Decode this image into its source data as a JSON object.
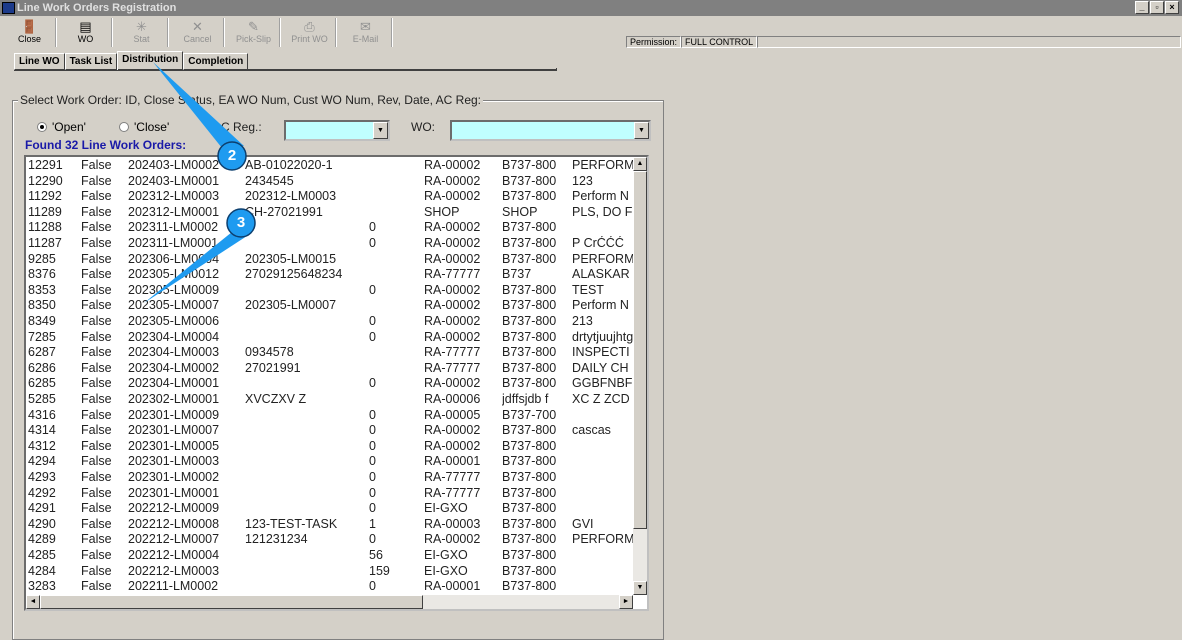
{
  "window": {
    "title": "Line Work Orders Registration"
  },
  "toolbar": [
    {
      "label": "Close",
      "icon": "door-exit-icon",
      "enabled": true
    },
    {
      "label": "WO",
      "icon": "printer-icon",
      "enabled": true
    },
    {
      "label": "Stat",
      "icon": "stat-icon",
      "enabled": false
    },
    {
      "label": "Cancel",
      "icon": "x-icon",
      "enabled": false
    },
    {
      "label": "Pick-Slip",
      "icon": "pick-slip-icon",
      "enabled": false
    },
    {
      "label": "Print WO",
      "icon": "print-icon",
      "enabled": false
    },
    {
      "label": "E-Mail",
      "icon": "email-icon",
      "enabled": false
    }
  ],
  "permission": {
    "label": "Permission:",
    "value": "FULL CONTROL"
  },
  "tabs": [
    "Line WO",
    "Task List",
    "Distribution",
    "Completion"
  ],
  "active_tab": "Distribution",
  "group": {
    "legend": "Select Work Order: ID, Close Status, EA WO Num, Cust WO Num, Rev, Date, AC Reg:",
    "radio_open": "'Open'",
    "radio_close": "'Close'",
    "ac_reg_label": "AC Reg.:",
    "wo_label": "WO:",
    "ac_reg_value": "",
    "wo_value": ""
  },
  "found": "Found 32 Line Work Orders:",
  "rows": [
    [
      "12291",
      "False",
      "202403-LM0002",
      "AB-01022020-1",
      "",
      "RA-00002",
      "B737-800",
      "PERFORM"
    ],
    [
      "12290",
      "False",
      "202403-LM0001",
      "2434545",
      "",
      "RA-00002",
      "B737-800",
      "123"
    ],
    [
      "11292",
      "False",
      "202312-LM0003",
      "202312-LM0003",
      "",
      "RA-00002",
      "B737-800",
      "Perform N"
    ],
    [
      "11289",
      "False",
      "202312-LM0001",
      "CH-27021991",
      "",
      "SHOP",
      "SHOP",
      "PLS, DO F"
    ],
    [
      "11288",
      "False",
      "202311-LM0002",
      "",
      "0",
      "RA-00002",
      "B737-800",
      ""
    ],
    [
      "11287",
      "False",
      "202311-LM0001",
      "",
      "0",
      "RA-00002",
      "B737-800",
      "P CrĆĆĆ"
    ],
    [
      "9285",
      "False",
      "202306-LM0004",
      "202305-LM0015",
      "",
      "RA-00002",
      "B737-800",
      "PERFORM"
    ],
    [
      "8376",
      "False",
      "202305-LM0012",
      "27029125648234",
      "",
      "RA-77777",
      "B737",
      "ALASKAR"
    ],
    [
      "8353",
      "False",
      "202305-LM0009",
      "",
      "0",
      "RA-00002",
      "B737-800",
      "TEST"
    ],
    [
      "8350",
      "False",
      "202305-LM0007",
      "202305-LM0007",
      "",
      "RA-00002",
      "B737-800",
      "Perform N"
    ],
    [
      "8349",
      "False",
      "202305-LM0006",
      "",
      "0",
      "RA-00002",
      "B737-800",
      "213"
    ],
    [
      "7285",
      "False",
      "202304-LM0004",
      "",
      "0",
      "RA-00002",
      "B737-800",
      "drtytjuujhtg"
    ],
    [
      "6287",
      "False",
      "202304-LM0003",
      "0934578",
      "",
      "RA-77777",
      "B737-800",
      "INSPECTI"
    ],
    [
      "6286",
      "False",
      "202304-LM0002",
      "27021991",
      "",
      "RA-77777",
      "B737-800",
      "DAILY CH"
    ],
    [
      "6285",
      "False",
      "202304-LM0001",
      "",
      "0",
      "RA-00002",
      "B737-800",
      "GGBFNBF"
    ],
    [
      "5285",
      "False",
      "202302-LM0001",
      "XVCZXV Z",
      "",
      "RA-00006",
      "jdffsjdb f",
      "XC Z ZCD"
    ],
    [
      "4316",
      "False",
      "202301-LM0009",
      "",
      "0",
      "RA-00005",
      "B737-700",
      ""
    ],
    [
      "4314",
      "False",
      "202301-LM0007",
      "",
      "0",
      "RA-00002",
      "B737-800",
      "cascas"
    ],
    [
      "4312",
      "False",
      "202301-LM0005",
      "",
      "0",
      "RA-00002",
      "B737-800",
      ""
    ],
    [
      "4294",
      "False",
      "202301-LM0003",
      "",
      "0",
      "RA-00001",
      "B737-800",
      ""
    ],
    [
      "4293",
      "False",
      "202301-LM0002",
      "",
      "0",
      "RA-77777",
      "B737-800",
      ""
    ],
    [
      "4292",
      "False",
      "202301-LM0001",
      "",
      "0",
      "RA-77777",
      "B737-800",
      ""
    ],
    [
      "4291",
      "False",
      "202212-LM0009",
      "",
      "0",
      "EI-GXO",
      "B737-800",
      ""
    ],
    [
      "4290",
      "False",
      "202212-LM0008",
      "123-TEST-TASK",
      "1",
      "RA-00003",
      "B737-800",
      "GVI"
    ],
    [
      "4289",
      "False",
      "202212-LM0007",
      "121231234",
      "0",
      "RA-00002",
      "B737-800",
      "PERFORM"
    ],
    [
      "4285",
      "False",
      "202212-LM0004",
      "",
      "56",
      "EI-GXO",
      "B737-800",
      ""
    ],
    [
      "4284",
      "False",
      "202212-LM0003",
      "",
      "159",
      "EI-GXO",
      "B737-800",
      ""
    ],
    [
      "3283",
      "False",
      "202211-LM0002",
      "",
      "0",
      "RA-00001",
      "B737-800",
      ""
    ]
  ],
  "callouts": [
    "2",
    "3"
  ],
  "colors": {
    "callout": "#1e9bf0",
    "found": "#1a1aa8",
    "combo": "#c0ffff"
  }
}
